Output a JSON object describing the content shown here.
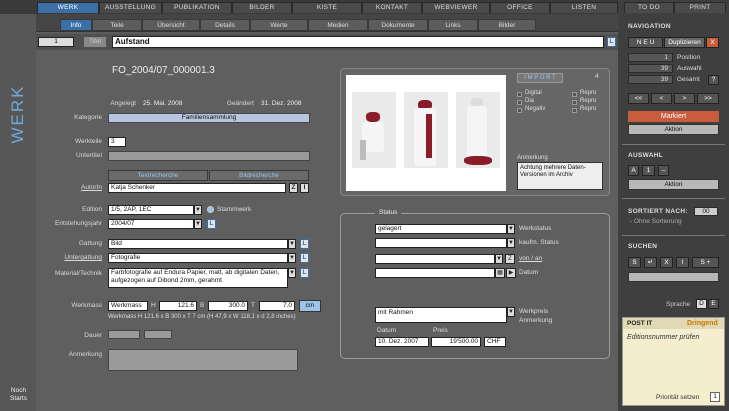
{
  "main_tabs": [
    "WERK",
    "AUSSTELLUNG",
    "PUBLIKATION",
    "BILDER",
    "KISTE",
    "KONTAKT",
    "WEBVIEWER",
    "OFFICE",
    "LISTEN"
  ],
  "right_tabs": [
    "TO DO",
    "PRINT"
  ],
  "sub_tabs": [
    "Info",
    "Teile",
    "Übersicht",
    "Details",
    "Werte",
    "Medien",
    "Dokumente",
    "Links",
    "Bilder"
  ],
  "record": {
    "number": "1",
    "title_label": "Titel",
    "title": "Aufstand",
    "l": "L"
  },
  "side": {
    "title": "WERK",
    "noch": "Noch",
    "starts": "Starts"
  },
  "form": {
    "werknr": "FO_2004/07_000001.3",
    "angelegt_label": "Angelegt",
    "angelegt": "25. Mai. 2008",
    "geaendert_label": "Geändert",
    "geaendert": "31. Dez. 2008",
    "kategorie_label": "Kategorie",
    "kategorie": "Familiensammlung",
    "werkteile_label": "Werkteile",
    "werkteile": "3",
    "untertitel_label": "Untertitel",
    "textrecherche": "Textrecherche",
    "bildrecherche": "Bildrecherche",
    "autorin_label": "AutorIn",
    "autorin": "Katja Schenker",
    "z": "Z",
    "i": "I",
    "edition_label": "Edition",
    "edition": "1/5, 2AP, 1EC",
    "stammwerk": "Stammwerk",
    "entstehung_label": "Entstehungsjahr",
    "entstehung": "2004/07",
    "gattung_label": "Gattung",
    "gattung": "Bild",
    "untergattung_label": "Untergattung",
    "untergattung": "Fotografie",
    "material_label": "Material/Technik",
    "material": "Farbfotografie auf Endura Papier, matt, ab digitalen Daten, aufgezogen auf Dibond 2mm, gerahmt",
    "werkmass_label": "Werkmass",
    "werkmass": "Werkmass",
    "h": "H",
    "h_val": "121.6",
    "b": "B",
    "b_val": "300.0",
    "t": "T",
    "t_val": "7.0",
    "unit": "cm",
    "werkmass_text": "Werkmass H 121.6 x B 300 x T 7 cm (H 47,9 x W 118,1 x d 2,8 inches)",
    "dauer_label": "Dauer",
    "anmerkung_label": "Anmerkung"
  },
  "image": {
    "import": "I M P O R T",
    "count": "4",
    "digital": "Digital",
    "dia": "Dia",
    "negativ": "Negativ",
    "repro": "Repro",
    "anmerkung_label": "Anmerkung",
    "anmerkung": "Achtung mehrere Daten-Versionen im Archiv"
  },
  "status": {
    "heading": "Status",
    "werkstatus": "gelagert",
    "werkstatus_label": "Werkstatus",
    "kaufm_label": "kaufm. Status",
    "vonan_label": "von / an",
    "datum_label": "Datum",
    "rahmen": "mit Rahmen",
    "werkpreis_label": "Werkpreis",
    "anmerkung_label": "Anmerkung",
    "datum_col": "Datum",
    "preis_col": "Preis",
    "datum_val": "10. Dez. 2007",
    "preis_val": "19'500.00",
    "currency": "CHF"
  },
  "nav": {
    "heading": "NAVIGATION",
    "neu": "N E U",
    "dup": "Duplizieren",
    "x": "X",
    "position": "1",
    "position_label": "Position",
    "auswahl": "39",
    "auswahl_label": "Auswahl",
    "gesamt": "39",
    "gesamt_label": "Gesamt",
    "q": "?",
    "first": "<<",
    "prev": "<",
    "next": ">",
    "last": ">>",
    "markiert": "Markiert",
    "aktion": "Aktion"
  },
  "auswahl": {
    "heading": "AUSWAHL",
    "a": "A",
    "one": "1",
    "dash": "–",
    "aktion": "Aktion"
  },
  "sort": {
    "heading": "SORTIERT NACH:",
    "value": "00",
    "note": "- Ohne Sortierung"
  },
  "suchen": {
    "heading": "SUCHEN",
    "s": "S",
    "back": "↵",
    "x": "X",
    "i": "I",
    "splus": "S +"
  },
  "sprache": {
    "label": "Sprache",
    "d": "D",
    "e": "E"
  },
  "postit": {
    "label": "POST IT",
    "priority_label": "Dringend",
    "text": "Editionsnummer prüfen",
    "prio_set": "Priorität setzen",
    "prio_val": "1"
  },
  "colors": {
    "accent": "#3c6fa8",
    "markiert": "#c85c3c",
    "dringend": "#c87800"
  }
}
